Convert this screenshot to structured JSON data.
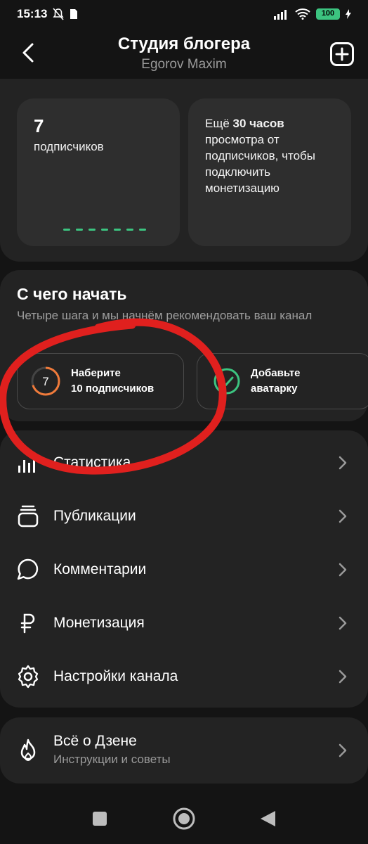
{
  "status_bar": {
    "time": "15:13",
    "battery": "100"
  },
  "header": {
    "title": "Студия блогера",
    "subtitle": "Egorov Maxim"
  },
  "stats": {
    "subscribers_count": "7",
    "subscribers_label": "подписчиков",
    "monetization_prefix": "Ещё ",
    "monetization_bold": "30 часов",
    "monetization_rest": "просмотра от подписчиков, чтобы подключить монетизацию"
  },
  "getting_started": {
    "title": "С чего начать",
    "subtitle": "Четыре шага и мы начнём рекомендовать ваш канал",
    "step1": {
      "badge": "7",
      "line1": "Наберите",
      "line2": "10 подписчиков",
      "progress": 0.7
    },
    "step2": {
      "line1": "Добавьте",
      "line2": "аватарку"
    }
  },
  "menu": {
    "statistics": "Статистика",
    "publications": "Публикации",
    "comments": "Комментарии",
    "monetization": "Монетизация",
    "settings": "Настройки канала"
  },
  "about": {
    "title": "Всё о Дзене",
    "subtitle": "Инструкции и советы"
  },
  "colors": {
    "accent_green": "#3cc480",
    "accent_orange": "#f07a3a",
    "annotation_red": "#e0201e"
  }
}
